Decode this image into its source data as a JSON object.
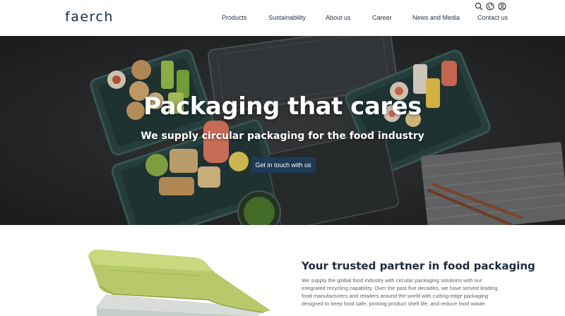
{
  "brand": {
    "logo_text": "faerch"
  },
  "nav": {
    "items": [
      {
        "label": "Products"
      },
      {
        "label": "Sustainability"
      },
      {
        "label": "About us"
      },
      {
        "label": "Career"
      },
      {
        "label": "News and Media"
      },
      {
        "label": "Contact us"
      }
    ],
    "utility_icons": [
      "search-icon",
      "globe-icon",
      "user-icon"
    ]
  },
  "hero": {
    "title": "Packaging that cares",
    "subtitle": "We supply circular packaging for the food industry",
    "cta_label": "Get in touch with us"
  },
  "intro": {
    "title": "Your trusted partner in food packaging",
    "body": "We supply the global food industry with circular packaging solutions with our integrated recycling capability. Over the past five decades, we have served leading food manufacturers and retailers around the world with cutting-edge packaging designed to keep food safe, prolong product shelf life, and reduce food waste."
  },
  "colors": {
    "cta_bg": "#1e3b56",
    "logo": "#1b2c4a",
    "tray_green": "#2f4f4a",
    "product_green": "#b7c96a"
  }
}
